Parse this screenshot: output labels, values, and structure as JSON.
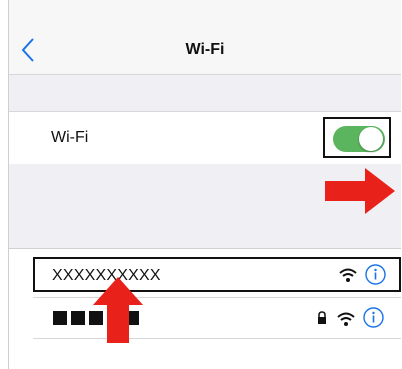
{
  "navbar": {
    "back_icon": "chevron-left-icon",
    "title": "Wi-Fi"
  },
  "wifi_row": {
    "label": "Wi-Fi",
    "toggle_state": "on",
    "toggle_color": "#5ab55e"
  },
  "networks": [
    {
      "ssid": "XXXXXXXXXX",
      "secured": false,
      "highlighted": true,
      "icons": [
        "wifi-icon",
        "info-icon"
      ]
    },
    {
      "ssid_hidden_blocks": 5,
      "secured": true,
      "highlighted": false,
      "icons": [
        "lock-icon",
        "wifi-icon",
        "info-icon"
      ]
    }
  ],
  "colors": {
    "accent": "#1a73e8",
    "annotation_arrow": "#e8221b",
    "group_background": "#efeff4"
  }
}
